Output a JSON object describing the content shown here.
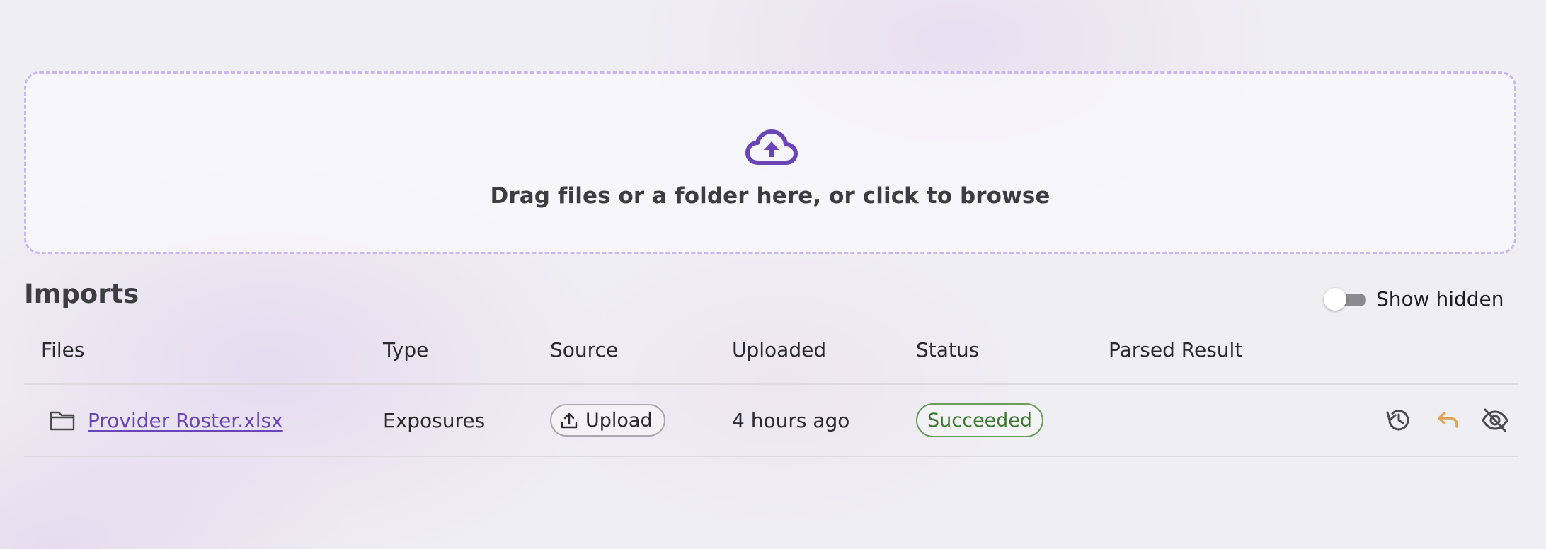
{
  "dropzone": {
    "icon": "cloud-upload-icon",
    "text": "Drag files or a folder here, or click to browse",
    "accent_color": "#6a45b8",
    "border_color": "#c8b8f2"
  },
  "imports": {
    "title": "Imports",
    "show_hidden": {
      "label": "Show hidden",
      "checked": false
    },
    "columns": {
      "files": "Files",
      "type": "Type",
      "source": "Source",
      "uploaded": "Uploaded",
      "status": "Status",
      "parsed_result": "Parsed Result"
    },
    "rows": [
      {
        "file_icon": "folder-icon",
        "file_name": "Provider Roster.xlsx",
        "type": "Exposures",
        "source_icon": "upload-icon",
        "source": "Upload",
        "uploaded": "4 hours ago",
        "status": "Succeeded",
        "status_color": "#3f7a33",
        "parsed_result": "",
        "actions": [
          "history-icon",
          "undo-icon",
          "eye-off-icon"
        ],
        "undo_color": "#e0a35a"
      }
    ]
  }
}
